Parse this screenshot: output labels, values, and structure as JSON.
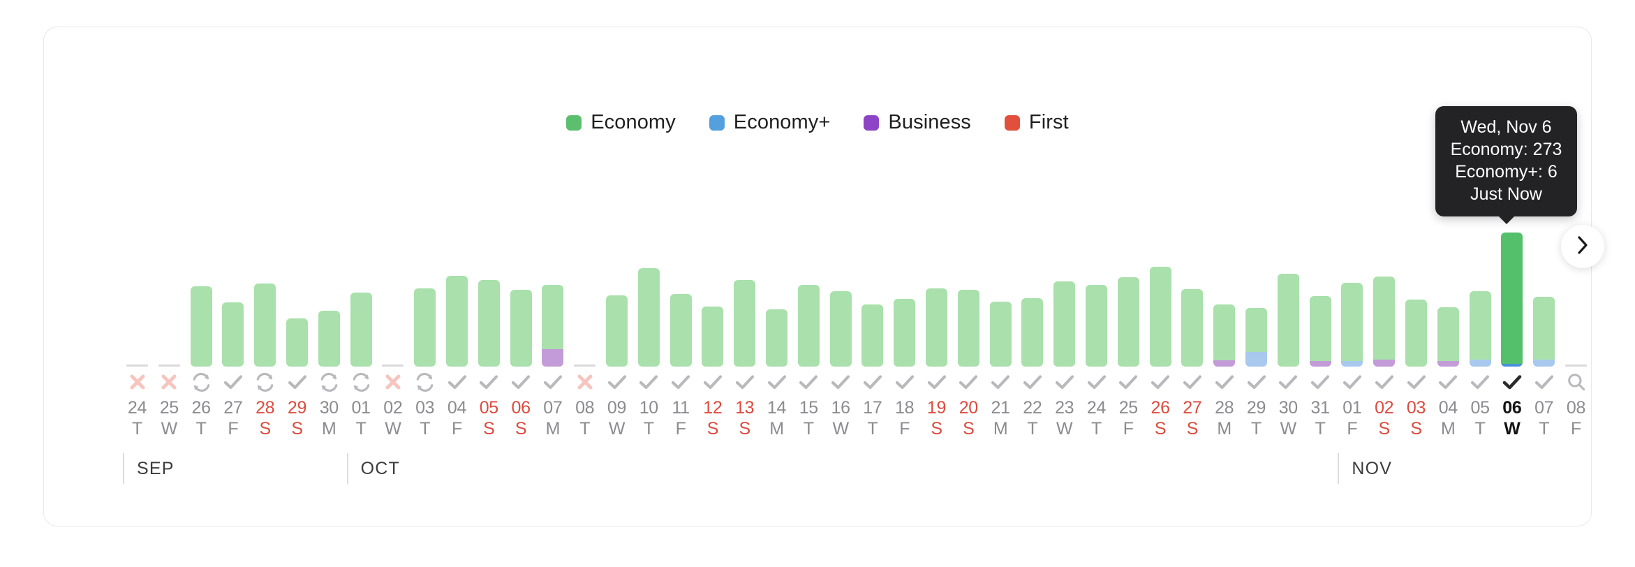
{
  "legend": {
    "items": [
      {
        "label": "Economy",
        "color": "#5BBF6E"
      },
      {
        "label": "Economy+",
        "color": "#54A0DE"
      },
      {
        "label": "Business",
        "color": "#8E44C6"
      },
      {
        "label": "First",
        "color": "#E0503C"
      }
    ]
  },
  "tooltip": {
    "date": "Wed, Nov 6",
    "economy": "Economy: 273",
    "economy_plus": "Economy+: 6",
    "updated": "Just Now"
  },
  "controls": {
    "next_label": "›",
    "next_icon": "chevron-right-icon",
    "search_icon": "search-icon"
  },
  "months": [
    {
      "name": "SEP",
      "start_index": 0
    },
    {
      "name": "OCT",
      "start_index": 7
    },
    {
      "name": "NOV",
      "start_index": 38
    }
  ],
  "colors": {
    "economy": "#A9E0AC",
    "economy_plus": "#A8C8EE",
    "business": "#C39BD8",
    "first": "#E89A8E",
    "economy_active": "#55C06C",
    "economy_plus_active": "#4A90DB",
    "empty_bar": "#d9d9dd",
    "weekend_text": "#dc4b3e",
    "normal_text": "#8b8b90",
    "selected_text": "#141416",
    "tooltip_bg": "#232326",
    "card_border": "#e8e8ea"
  },
  "chart_data": {
    "type": "bar",
    "stacked": true,
    "title": "",
    "xlabel": "",
    "ylabel": "",
    "ylim": [
      0,
      300
    ],
    "grid": false,
    "legend_position": "top-center",
    "series": [
      {
        "name": "Economy",
        "color": "#A9E0AC"
      },
      {
        "name": "Economy+",
        "color": "#A8C8EE"
      },
      {
        "name": "Business",
        "color": "#C39BD8"
      },
      {
        "name": "First",
        "color": "#E0503C"
      }
    ],
    "annotations": [
      {
        "index": 43,
        "text": "Wed, Nov 6 — Economy: 273, Economy+: 6 — Just Now"
      }
    ],
    "days": [
      {
        "day": "24",
        "dow": "T",
        "month": "SEP",
        "weekend": false,
        "status": "error",
        "selected": false,
        "economy": 0,
        "economy_plus": 0,
        "business": 0,
        "first": 0
      },
      {
        "day": "25",
        "dow": "W",
        "month": "SEP",
        "weekend": false,
        "status": "error",
        "selected": false,
        "economy": 0,
        "economy_plus": 0,
        "business": 0,
        "first": 0
      },
      {
        "day": "26",
        "dow": "T",
        "month": "SEP",
        "weekend": false,
        "status": "sync",
        "selected": false,
        "economy": 168,
        "economy_plus": 0,
        "business": 0,
        "first": 0
      },
      {
        "day": "27",
        "dow": "F",
        "month": "SEP",
        "weekend": false,
        "status": "check",
        "selected": false,
        "economy": 134,
        "economy_plus": 0,
        "business": 0,
        "first": 0
      },
      {
        "day": "28",
        "dow": "S",
        "month": "SEP",
        "weekend": true,
        "status": "sync",
        "selected": false,
        "economy": 174,
        "economy_plus": 0,
        "business": 0,
        "first": 0
      },
      {
        "day": "29",
        "dow": "S",
        "month": "SEP",
        "weekend": true,
        "status": "check",
        "selected": false,
        "economy": 100,
        "economy_plus": 0,
        "business": 0,
        "first": 0
      },
      {
        "day": "30",
        "dow": "M",
        "month": "SEP",
        "weekend": false,
        "status": "sync",
        "selected": false,
        "economy": 116,
        "economy_plus": 0,
        "business": 0,
        "first": 0
      },
      {
        "day": "01",
        "dow": "T",
        "month": "OCT",
        "weekend": false,
        "status": "sync",
        "selected": false,
        "economy": 155,
        "economy_plus": 0,
        "business": 0,
        "first": 0
      },
      {
        "day": "02",
        "dow": "W",
        "month": "OCT",
        "weekend": false,
        "status": "error",
        "selected": false,
        "economy": 0,
        "economy_plus": 0,
        "business": 0,
        "first": 0
      },
      {
        "day": "03",
        "dow": "T",
        "month": "OCT",
        "weekend": false,
        "status": "sync",
        "selected": false,
        "economy": 163,
        "economy_plus": 0,
        "business": 0,
        "first": 0
      },
      {
        "day": "04",
        "dow": "F",
        "month": "OCT",
        "weekend": false,
        "status": "check",
        "selected": false,
        "economy": 190,
        "economy_plus": 0,
        "business": 0,
        "first": 0
      },
      {
        "day": "05",
        "dow": "S",
        "month": "OCT",
        "weekend": true,
        "status": "check",
        "selected": false,
        "economy": 180,
        "economy_plus": 0,
        "business": 0,
        "first": 0
      },
      {
        "day": "06",
        "dow": "S",
        "month": "OCT",
        "weekend": true,
        "status": "check",
        "selected": false,
        "economy": 160,
        "economy_plus": 0,
        "business": 0,
        "first": 0
      },
      {
        "day": "07",
        "dow": "M",
        "month": "OCT",
        "weekend": false,
        "status": "check",
        "selected": false,
        "economy": 133,
        "economy_plus": 0,
        "business": 37,
        "first": 0
      },
      {
        "day": "08",
        "dow": "T",
        "month": "OCT",
        "weekend": false,
        "status": "error",
        "selected": false,
        "economy": 0,
        "economy_plus": 0,
        "business": 0,
        "first": 0
      },
      {
        "day": "09",
        "dow": "W",
        "month": "OCT",
        "weekend": false,
        "status": "check",
        "selected": false,
        "economy": 148,
        "economy_plus": 0,
        "business": 0,
        "first": 0
      },
      {
        "day": "10",
        "dow": "T",
        "month": "OCT",
        "weekend": false,
        "status": "check",
        "selected": false,
        "economy": 205,
        "economy_plus": 0,
        "business": 0,
        "first": 0
      },
      {
        "day": "11",
        "dow": "F",
        "month": "OCT",
        "weekend": false,
        "status": "check",
        "selected": false,
        "economy": 152,
        "economy_plus": 0,
        "business": 0,
        "first": 0
      },
      {
        "day": "12",
        "dow": "S",
        "month": "OCT",
        "weekend": true,
        "status": "check",
        "selected": false,
        "economy": 125,
        "economy_plus": 0,
        "business": 0,
        "first": 0
      },
      {
        "day": "13",
        "dow": "S",
        "month": "OCT",
        "weekend": true,
        "status": "check",
        "selected": false,
        "economy": 180,
        "economy_plus": 0,
        "business": 0,
        "first": 0
      },
      {
        "day": "14",
        "dow": "M",
        "month": "OCT",
        "weekend": false,
        "status": "check",
        "selected": false,
        "economy": 120,
        "economy_plus": 0,
        "business": 0,
        "first": 0
      },
      {
        "day": "15",
        "dow": "T",
        "month": "OCT",
        "weekend": false,
        "status": "check",
        "selected": false,
        "economy": 170,
        "economy_plus": 0,
        "business": 0,
        "first": 0
      },
      {
        "day": "16",
        "dow": "W",
        "month": "OCT",
        "weekend": false,
        "status": "check",
        "selected": false,
        "economy": 157,
        "economy_plus": 0,
        "business": 0,
        "first": 0
      },
      {
        "day": "17",
        "dow": "T",
        "month": "OCT",
        "weekend": false,
        "status": "check",
        "selected": false,
        "economy": 130,
        "economy_plus": 0,
        "business": 0,
        "first": 0
      },
      {
        "day": "18",
        "dow": "F",
        "month": "OCT",
        "weekend": false,
        "status": "check",
        "selected": false,
        "economy": 142,
        "economy_plus": 0,
        "business": 0,
        "first": 0
      },
      {
        "day": "19",
        "dow": "S",
        "month": "OCT",
        "weekend": true,
        "status": "check",
        "selected": false,
        "economy": 163,
        "economy_plus": 0,
        "business": 0,
        "first": 0
      },
      {
        "day": "20",
        "dow": "S",
        "month": "OCT",
        "weekend": true,
        "status": "check",
        "selected": false,
        "economy": 160,
        "economy_plus": 0,
        "business": 0,
        "first": 0
      },
      {
        "day": "21",
        "dow": "M",
        "month": "OCT",
        "weekend": false,
        "status": "check",
        "selected": false,
        "economy": 135,
        "economy_plus": 0,
        "business": 0,
        "first": 0
      },
      {
        "day": "22",
        "dow": "T",
        "month": "OCT",
        "weekend": false,
        "status": "check",
        "selected": false,
        "economy": 143,
        "economy_plus": 0,
        "business": 0,
        "first": 0
      },
      {
        "day": "23",
        "dow": "W",
        "month": "OCT",
        "weekend": false,
        "status": "check",
        "selected": false,
        "economy": 178,
        "economy_plus": 0,
        "business": 0,
        "first": 0
      },
      {
        "day": "24",
        "dow": "T",
        "month": "OCT",
        "weekend": false,
        "status": "check",
        "selected": false,
        "economy": 170,
        "economy_plus": 0,
        "business": 0,
        "first": 0
      },
      {
        "day": "25",
        "dow": "F",
        "month": "OCT",
        "weekend": false,
        "status": "check",
        "selected": false,
        "economy": 187,
        "economy_plus": 0,
        "business": 0,
        "first": 0
      },
      {
        "day": "26",
        "dow": "S",
        "month": "OCT",
        "weekend": true,
        "status": "check",
        "selected": false,
        "economy": 208,
        "economy_plus": 0,
        "business": 0,
        "first": 0
      },
      {
        "day": "27",
        "dow": "S",
        "month": "OCT",
        "weekend": true,
        "status": "check",
        "selected": false,
        "economy": 162,
        "economy_plus": 0,
        "business": 0,
        "first": 0
      },
      {
        "day": "28",
        "dow": "M",
        "month": "OCT",
        "weekend": false,
        "status": "check",
        "selected": false,
        "economy": 117,
        "economy_plus": 0,
        "business": 13,
        "first": 0
      },
      {
        "day": "29",
        "dow": "T",
        "month": "OCT",
        "weekend": false,
        "status": "check",
        "selected": false,
        "economy": 92,
        "economy_plus": 30,
        "business": 0,
        "first": 0
      },
      {
        "day": "30",
        "dow": "W",
        "month": "OCT",
        "weekend": false,
        "status": "check",
        "selected": false,
        "economy": 193,
        "economy_plus": 0,
        "business": 0,
        "first": 0
      },
      {
        "day": "31",
        "dow": "T",
        "month": "OCT",
        "weekend": false,
        "status": "check",
        "selected": false,
        "economy": 135,
        "economy_plus": 0,
        "business": 12,
        "first": 0
      },
      {
        "day": "01",
        "dow": "F",
        "month": "NOV",
        "weekend": false,
        "status": "check",
        "selected": false,
        "economy": 164,
        "economy_plus": 11,
        "business": 0,
        "first": 0
      },
      {
        "day": "02",
        "dow": "S",
        "month": "NOV",
        "weekend": true,
        "status": "check",
        "selected": false,
        "economy": 174,
        "economy_plus": 0,
        "business": 14,
        "first": 0
      },
      {
        "day": "03",
        "dow": "S",
        "month": "NOV",
        "weekend": true,
        "status": "check",
        "selected": false,
        "economy": 140,
        "economy_plus": 0,
        "business": 0,
        "first": 0
      },
      {
        "day": "04",
        "dow": "M",
        "month": "NOV",
        "weekend": false,
        "status": "check",
        "selected": false,
        "economy": 112,
        "economy_plus": 0,
        "business": 12,
        "first": 0
      },
      {
        "day": "05",
        "dow": "T",
        "month": "NOV",
        "weekend": false,
        "status": "check",
        "selected": false,
        "economy": 142,
        "economy_plus": 15,
        "business": 0,
        "first": 0
      },
      {
        "day": "06",
        "dow": "W",
        "month": "NOV",
        "weekend": false,
        "status": "check",
        "selected": true,
        "economy": 273,
        "economy_plus": 6,
        "business": 0,
        "first": 0
      },
      {
        "day": "07",
        "dow": "T",
        "month": "NOV",
        "weekend": false,
        "status": "check",
        "selected": false,
        "economy": 132,
        "economy_plus": 14,
        "business": 0,
        "first": 0
      },
      {
        "day": "08",
        "dow": "F",
        "month": "NOV",
        "weekend": false,
        "status": "search",
        "selected": false,
        "economy": 0,
        "economy_plus": 0,
        "business": 0,
        "first": 0
      }
    ]
  }
}
